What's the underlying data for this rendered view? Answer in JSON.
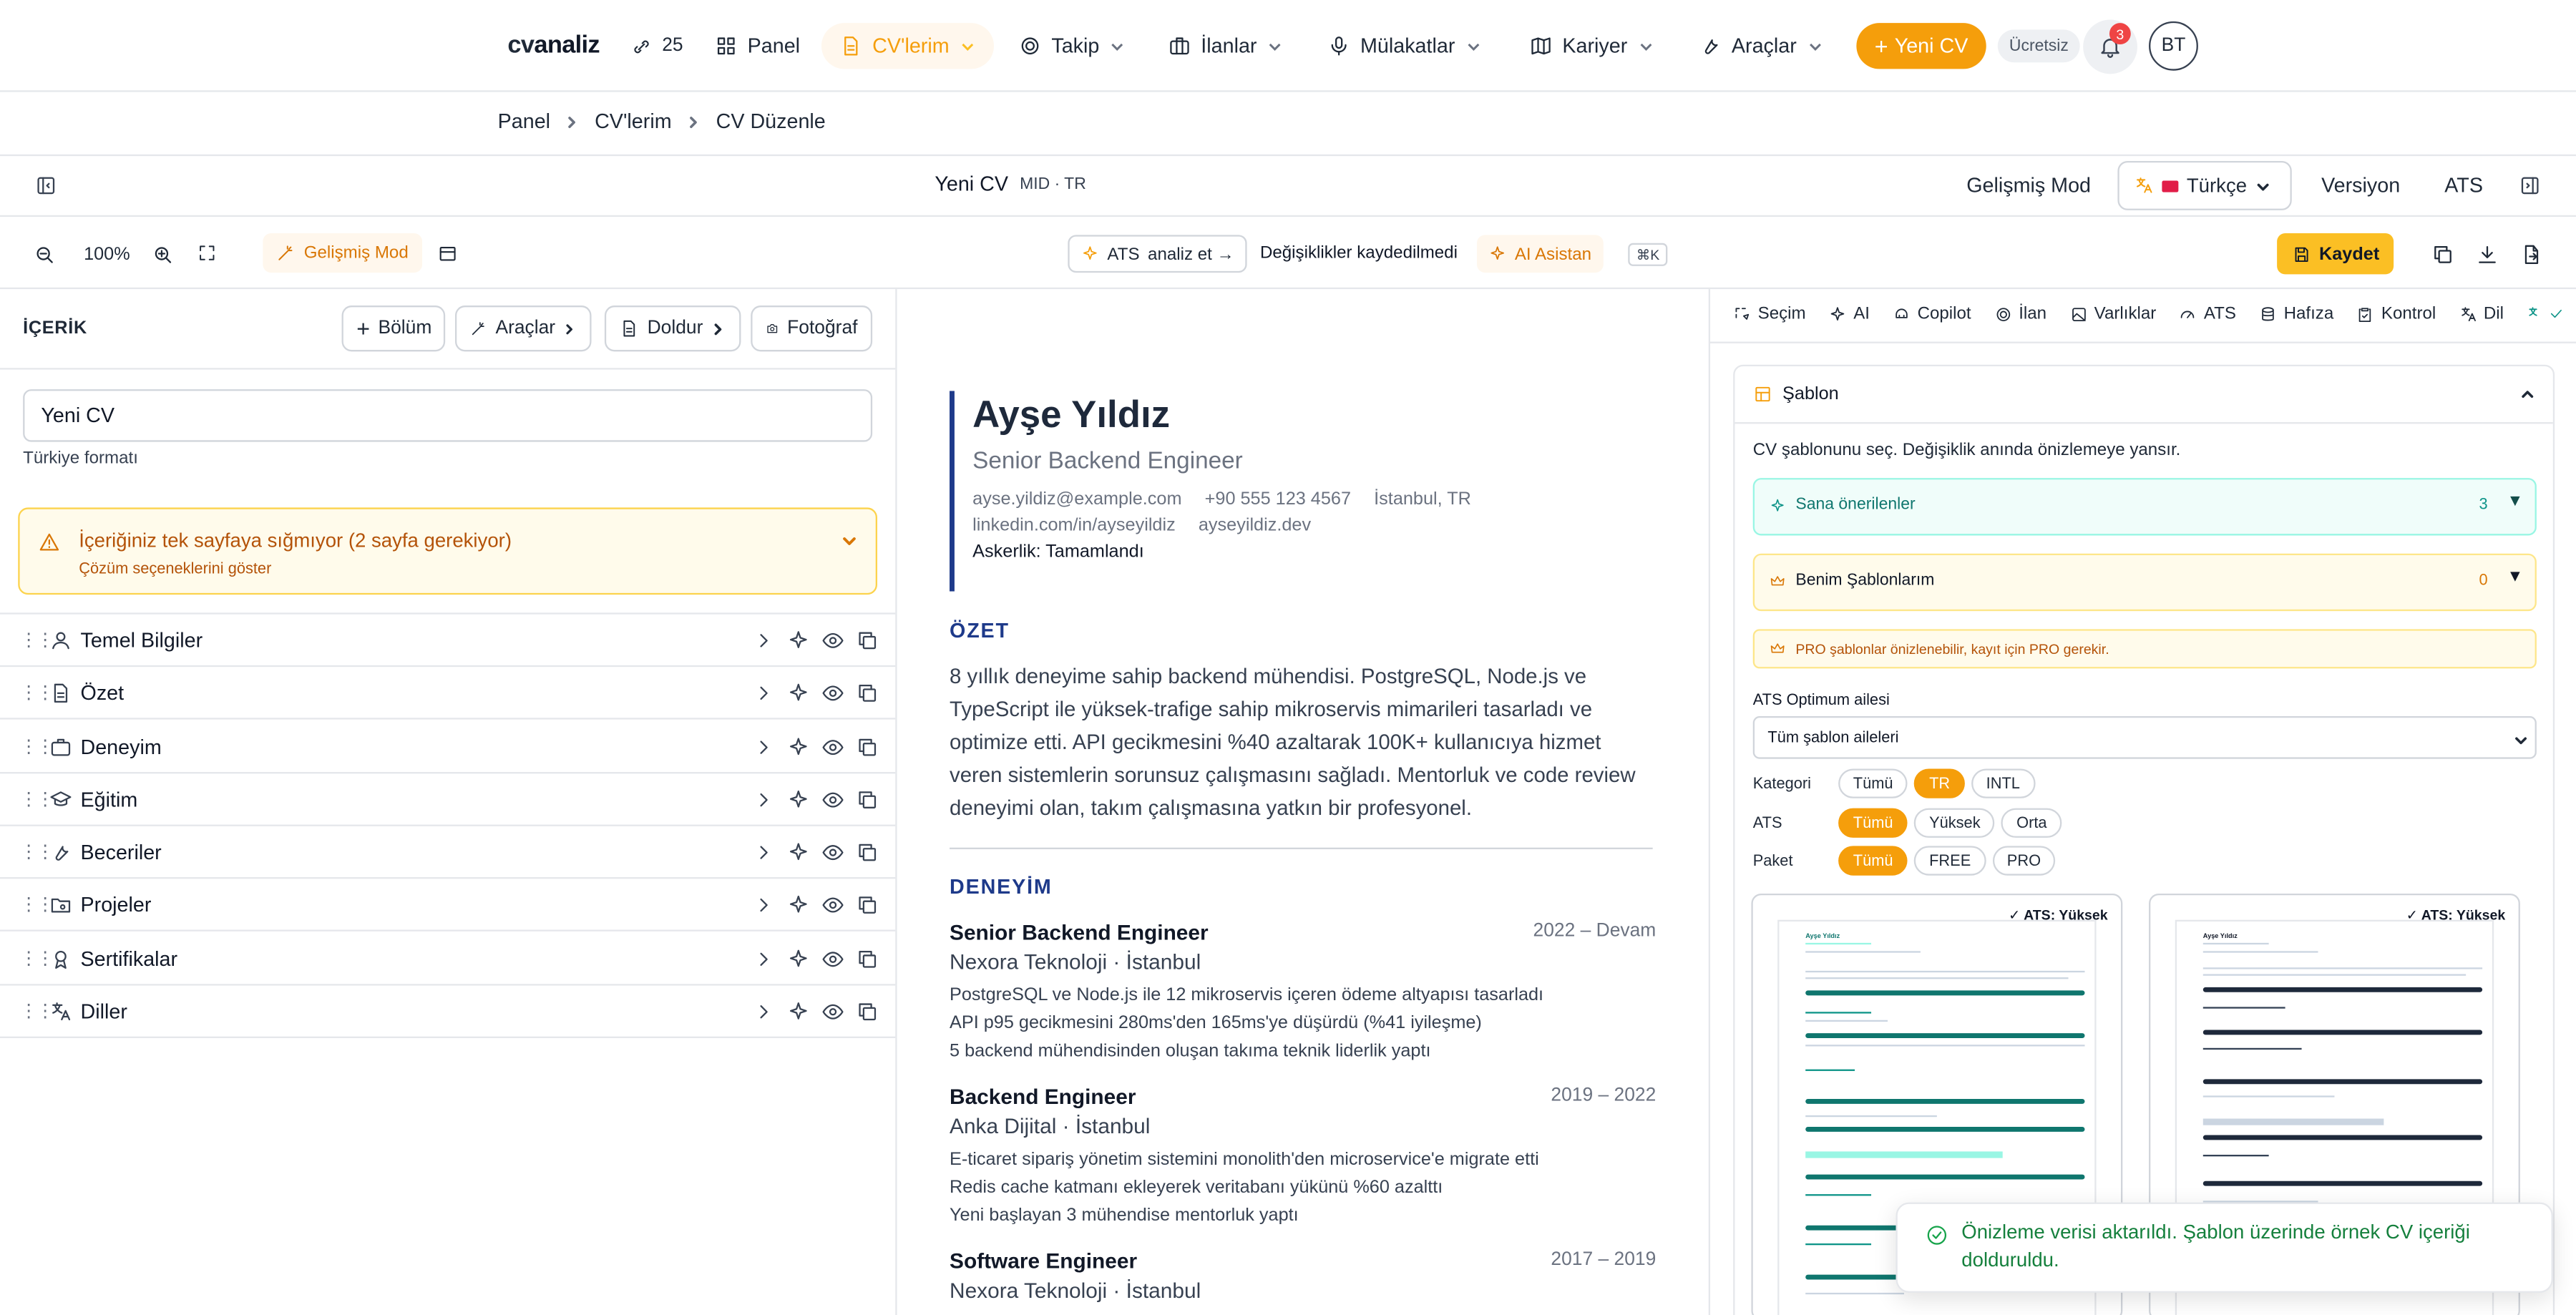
{
  "nav": {
    "logo_a": "cv",
    "logo_b": "analiz",
    "credits": "25",
    "items": [
      "Panel",
      "CV'lerim",
      "Takip",
      "İlanlar",
      "Mülakatlar",
      "Kariyer",
      "Araçlar"
    ],
    "new_cv": "Yeni CV",
    "plan": "Ücretsiz",
    "notifications": "3",
    "avatar": "BT",
    "colors": {
      "accent": "#f59e0b",
      "active_bg": "#fff7ed"
    }
  },
  "breadcrumb": [
    "Panel",
    "CV'lerim",
    "CV Düzenle"
  ],
  "doc": {
    "title": "Yeni CV",
    "meta": "MID · TR",
    "advanced_mode": "Gelişmiş Mod",
    "language": "Türkçe",
    "version": "Versiyon",
    "ats": "ATS"
  },
  "toolbar": {
    "zoom": "100%",
    "advanced_mode": "Gelişmiş Mod",
    "ats_label": "ATS",
    "ats_action": "analiz et →",
    "unsaved": "Değişiklikler kaydedilmedi",
    "ai_assistant": "AI Asistan",
    "shortcut": "⌘K",
    "save": "Kaydet"
  },
  "left": {
    "header": "İÇERİK",
    "buttons": [
      "Bölüm",
      "Araçlar",
      "Doldur",
      "Fotoğraf"
    ],
    "cv_name_value": "Yeni CV",
    "format": "Türkiye formatı",
    "warning_title": "İçeriğiniz tek sayfaya sığmıyor (2 sayfa gerekiyor)",
    "warning_link": "Çözüm seçeneklerini göster",
    "sections": [
      "Temel Bilgiler",
      "Özet",
      "Deneyim",
      "Eğitim",
      "Beceriler",
      "Projeler",
      "Sertifikalar",
      "Diller"
    ]
  },
  "cv": {
    "name": "Ayşe Yıldız",
    "role": "Senior Backend Engineer",
    "email": "ayse.yildiz@example.com",
    "phone": "+90 555 123 4567",
    "location": "İstanbul, TR",
    "linkedin": "linkedin.com/in/ayseyildiz",
    "website": "ayseyildiz.dev",
    "military": "Askerlik: Tamamlandı",
    "summary_heading": "ÖZET",
    "summary": "8 yıllık deneyime sahip backend mühendisi. PostgreSQL, Node.js ve TypeScript ile yüksek-trafige sahip mikroservis mimarileri tasarladı ve optimize etti. API gecikmesini %40 azaltarak 100K+ kullanıcıya hizmet veren sistemlerin sorunsuz çalışmasını sağladı. Mentorluk ve code review deneyimi olan, takım çalışmasına yatkın bir profesyonel.",
    "experience_heading": "DENEYİM",
    "experience": [
      {
        "title": "Senior Backend Engineer",
        "company": "Nexora Teknoloji · İstanbul",
        "date": "2022 – Devam",
        "bullets": [
          "PostgreSQL ve Node.js ile 12 mikroservis içeren ödeme altyapısı tasarladı",
          "API p95 gecikmesini 280ms'den 165ms'ye düşürdü (%41 iyileşme)",
          "5 backend mühendisinden oluşan takıma teknik liderlik yaptı"
        ]
      },
      {
        "title": "Backend Engineer",
        "company": "Anka Dijital · İstanbul",
        "date": "2019 – 2022",
        "bullets": [
          "E-ticaret sipariş yönetim sistemini monolith'den microservice'e migrate etti",
          "Redis cache katmanı ekleyerek veritabanı yükünü %60 azalttı",
          "Yeni başlayan 3 mühendise mentorluk yaptı"
        ]
      },
      {
        "title": "Software Engineer",
        "company": "Nexora Teknoloji · İstanbul",
        "date": "2017 – 2019",
        "bullets": []
      }
    ]
  },
  "right": {
    "tabs": [
      "Seçim",
      "AI",
      "Copilot",
      "İlan",
      "Varlıklar",
      "ATS",
      "Hafıza",
      "Kontrol",
      "Dil"
    ],
    "template_header": "Şablon",
    "template_desc": "CV şablonunu seç. Değişiklik anında önizlemeye yansır.",
    "recommended": "Sana önerilenler",
    "recommended_count": "3",
    "my_templates": "Benim Şablonlarım",
    "my_templates_count": "0",
    "pro_note": "PRO şablonlar önizlenebilir, kayıt için PRO gerekir.",
    "ats_family_label": "ATS Optimum ailesi",
    "ats_family_value": "Tüm şablon aileleri",
    "filters": [
      {
        "label": "Kategori",
        "options": [
          "Tümü",
          "TR",
          "INTL"
        ],
        "selected": "TR"
      },
      {
        "label": "ATS",
        "options": [
          "Tümü",
          "Yüksek",
          "Orta"
        ],
        "selected": "Tümü"
      },
      {
        "label": "Paket",
        "options": [
          "Tümü",
          "FREE",
          "PRO"
        ],
        "selected": "Tümü"
      }
    ],
    "thumb_badges": [
      "✓ ATS: Yüksek",
      "✓ ATS: Yüksek"
    ],
    "thumb_name": "Ayşe Yıldız"
  },
  "toast": "Önizleme verisi aktarıldı. Şablon üzerinde örnek CV içeriği dolduruldu."
}
